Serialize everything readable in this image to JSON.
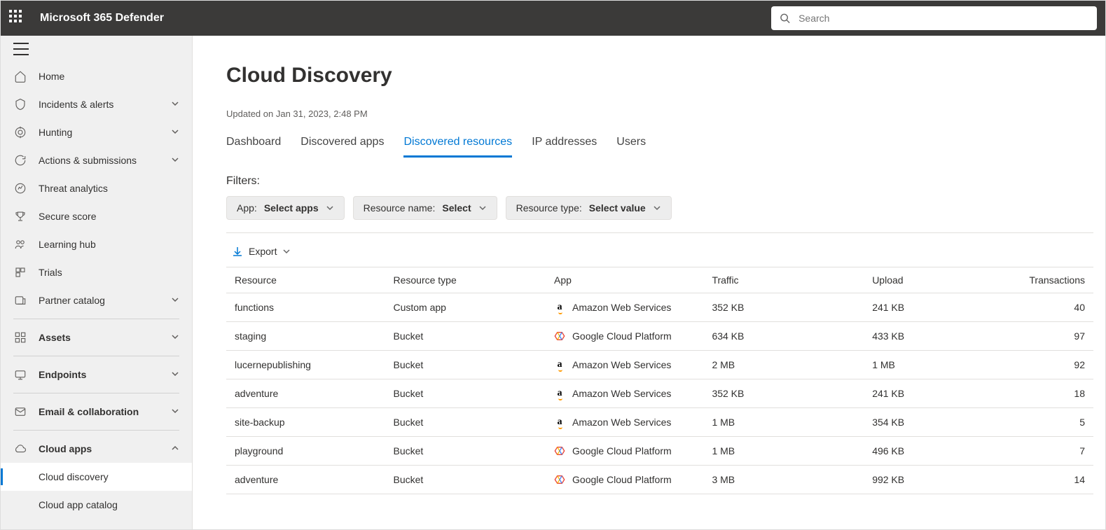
{
  "header": {
    "brand": "Microsoft 365 Defender",
    "search_placeholder": "Search"
  },
  "sidebar": {
    "items": [
      {
        "label": "Home",
        "expandable": false
      },
      {
        "label": "Incidents & alerts",
        "expandable": true
      },
      {
        "label": "Hunting",
        "expandable": true
      },
      {
        "label": "Actions & submissions",
        "expandable": true
      },
      {
        "label": "Threat analytics",
        "expandable": false
      },
      {
        "label": "Secure score",
        "expandable": false
      },
      {
        "label": "Learning hub",
        "expandable": false
      },
      {
        "label": "Trials",
        "expandable": false
      },
      {
        "label": "Partner catalog",
        "expandable": true
      }
    ],
    "groups": [
      {
        "label": "Assets"
      },
      {
        "label": "Endpoints"
      },
      {
        "label": "Email & collaboration"
      },
      {
        "label": "Cloud apps"
      }
    ],
    "sub": [
      {
        "label": "Cloud discovery",
        "selected": true
      },
      {
        "label": "Cloud app catalog",
        "selected": false
      }
    ]
  },
  "main": {
    "title": "Cloud Discovery",
    "updated_prefix": "Updated on ",
    "updated_value": "Jan 31, 2023, 2:48 PM",
    "tabs": [
      "Dashboard",
      "Discovered apps",
      "Discovered resources",
      "IP addresses",
      "Users"
    ],
    "active_tab": 2,
    "filters_label": "Filters:",
    "filters": [
      {
        "label": "App:",
        "value": "Select apps"
      },
      {
        "label": "Resource name:",
        "value": "Select"
      },
      {
        "label": "Resource type:",
        "value": "Select value"
      }
    ],
    "export_label": "Export",
    "columns": [
      "Resource",
      "Resource type",
      "App",
      "Traffic",
      "Upload",
      "Transactions"
    ],
    "rows": [
      {
        "resource": "functions",
        "type": "Custom app",
        "app": "Amazon Web Services",
        "app_icon": "aws",
        "traffic": "352 KB",
        "upload": "241 KB",
        "transactions": "40"
      },
      {
        "resource": "staging",
        "type": "Bucket",
        "app": "Google Cloud Platform",
        "app_icon": "gcp",
        "traffic": "634 KB",
        "upload": "433 KB",
        "transactions": "97"
      },
      {
        "resource": "lucernepublishing",
        "type": "Bucket",
        "app": "Amazon Web Services",
        "app_icon": "aws",
        "traffic": "2 MB",
        "upload": "1 MB",
        "transactions": "92"
      },
      {
        "resource": "adventure",
        "type": "Bucket",
        "app": "Amazon Web Services",
        "app_icon": "aws",
        "traffic": "352 KB",
        "upload": "241 KB",
        "transactions": "18"
      },
      {
        "resource": "site-backup",
        "type": "Bucket",
        "app": "Amazon Web Services",
        "app_icon": "aws",
        "traffic": "1 MB",
        "upload": "354 KB",
        "transactions": "5"
      },
      {
        "resource": "playground",
        "type": "Bucket",
        "app": "Google Cloud Platform",
        "app_icon": "gcp",
        "traffic": "1 MB",
        "upload": "496 KB",
        "transactions": "7"
      },
      {
        "resource": "adventure",
        "type": "Bucket",
        "app": "Google Cloud Platform",
        "app_icon": "gcp",
        "traffic": "3 MB",
        "upload": "992 KB",
        "transactions": "14"
      }
    ]
  }
}
